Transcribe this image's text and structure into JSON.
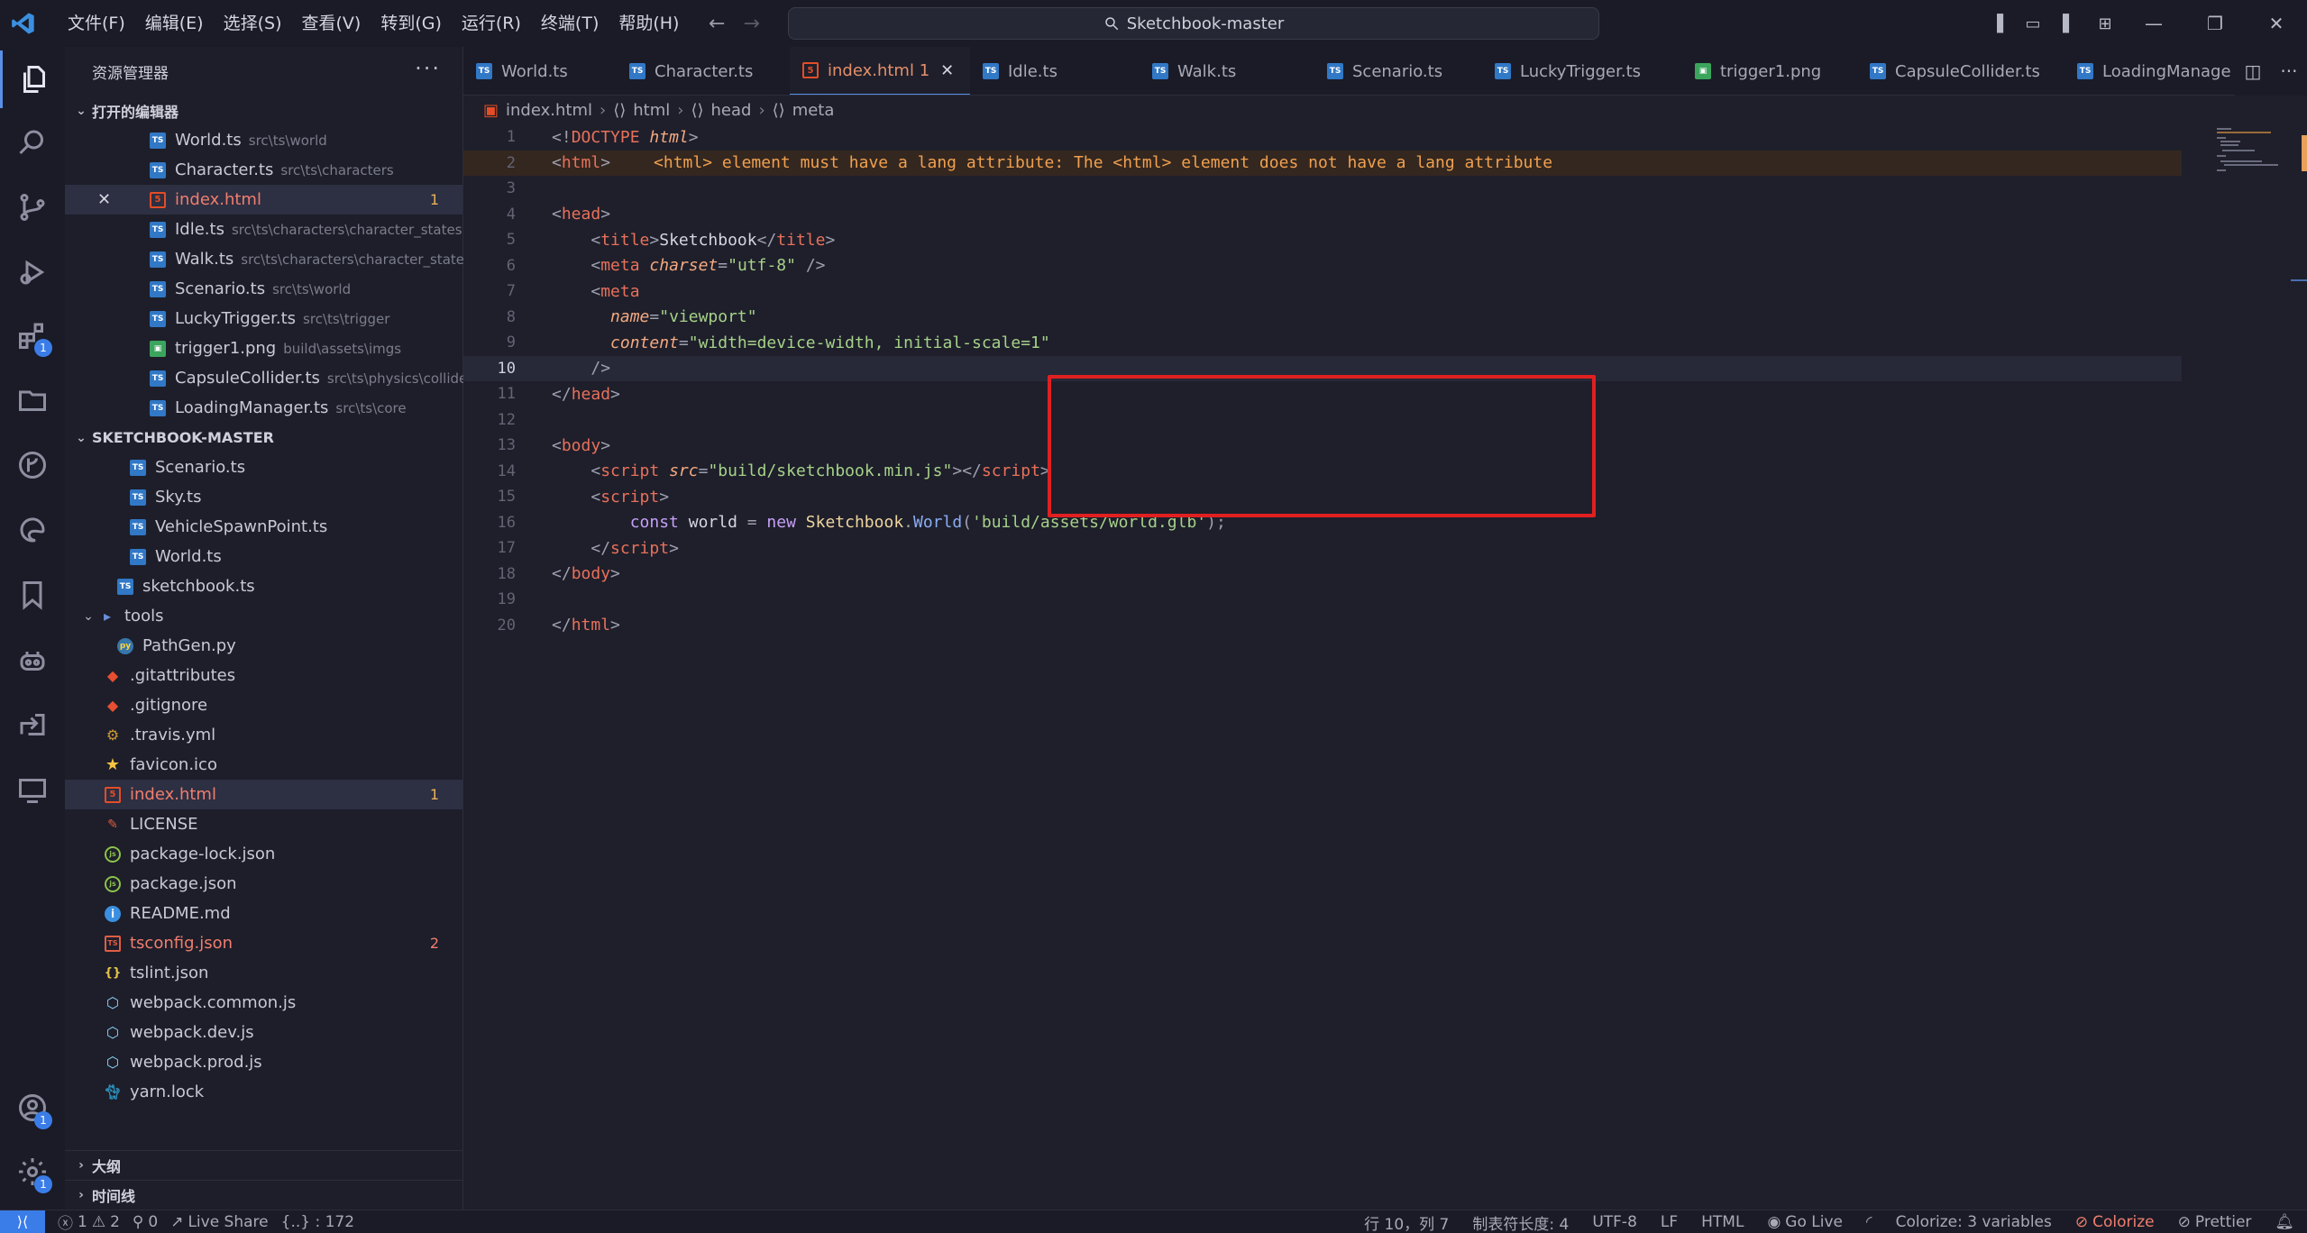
{
  "titlebar": {
    "menu": [
      "文件(F)",
      "编辑(E)",
      "选择(S)",
      "查看(V)",
      "转到(G)",
      "运行(R)",
      "终端(T)",
      "帮助(H)"
    ],
    "search_text": "Sketchbook-master"
  },
  "activitybar": {
    "extensions_badge": "1",
    "accounts_badge": "1",
    "settings_badge": "1"
  },
  "sidebar": {
    "title": "资源管理器",
    "open_editors_title": "打开的编辑器",
    "open_editors": [
      {
        "name": "World.ts",
        "path": "src\\ts\\world",
        "type": "ts"
      },
      {
        "name": "Character.ts",
        "path": "src\\ts\\characters",
        "type": "ts"
      },
      {
        "name": "index.html",
        "path": "",
        "type": "html",
        "badge": "1"
      },
      {
        "name": "Idle.ts",
        "path": "src\\ts\\characters\\character_states",
        "type": "ts"
      },
      {
        "name": "Walk.ts",
        "path": "src\\ts\\characters\\character_states",
        "type": "ts"
      },
      {
        "name": "Scenario.ts",
        "path": "src\\ts\\world",
        "type": "ts"
      },
      {
        "name": "LuckyTrigger.ts",
        "path": "src\\ts\\trigger",
        "type": "ts"
      },
      {
        "name": "trigger1.png",
        "path": "build\\assets\\imgs",
        "type": "png"
      },
      {
        "name": "CapsuleCollider.ts",
        "path": "src\\ts\\physics\\colliders",
        "type": "ts"
      },
      {
        "name": "LoadingManager.ts",
        "path": "src\\ts\\core",
        "type": "ts"
      }
    ],
    "project_title": "SKETCHBOOK-MASTER",
    "tree": [
      {
        "name": "Scenario.ts",
        "type": "ts",
        "indent": 3
      },
      {
        "name": "Sky.ts",
        "type": "ts",
        "indent": 3
      },
      {
        "name": "VehicleSpawnPoint.ts",
        "type": "ts",
        "indent": 3
      },
      {
        "name": "World.ts",
        "type": "ts",
        "indent": 3
      },
      {
        "name": "sketchbook.ts",
        "type": "ts",
        "indent": 2
      },
      {
        "name": "tools",
        "type": "folder",
        "indent": 1
      },
      {
        "name": "PathGen.py",
        "type": "py",
        "indent": 2
      },
      {
        "name": ".gitattributes",
        "type": "git",
        "indent": 1
      },
      {
        "name": ".gitignore",
        "type": "git",
        "indent": 1
      },
      {
        "name": ".travis.yml",
        "type": "yml",
        "indent": 1
      },
      {
        "name": "favicon.ico",
        "type": "star",
        "indent": 1
      },
      {
        "name": "index.html",
        "type": "html",
        "indent": 1,
        "badge": "1",
        "cls": "err"
      },
      {
        "name": "LICENSE",
        "type": "lic",
        "indent": 1
      },
      {
        "name": "package-lock.json",
        "type": "json",
        "indent": 1
      },
      {
        "name": "package.json",
        "type": "json",
        "indent": 1
      },
      {
        "name": "README.md",
        "type": "info",
        "indent": 1
      },
      {
        "name": "tsconfig.json",
        "type": "tsconfig",
        "indent": 1,
        "badge": "2",
        "cls": "err"
      },
      {
        "name": "tslint.json",
        "type": "braces",
        "indent": 1
      },
      {
        "name": "webpack.common.js",
        "type": "webpack",
        "indent": 1
      },
      {
        "name": "webpack.dev.js",
        "type": "webpack",
        "indent": 1
      },
      {
        "name": "webpack.prod.js",
        "type": "webpack",
        "indent": 1
      },
      {
        "name": "yarn.lock",
        "type": "yarn",
        "indent": 1
      }
    ],
    "outline_title": "大纲",
    "timeline_title": "时间线"
  },
  "tabs": [
    {
      "name": "World.ts",
      "type": "ts"
    },
    {
      "name": "Character.ts",
      "type": "ts"
    },
    {
      "name": "index.html 1",
      "type": "html",
      "active": true
    },
    {
      "name": "Idle.ts",
      "type": "ts"
    },
    {
      "name": "Walk.ts",
      "type": "ts"
    },
    {
      "name": "Scenario.ts",
      "type": "ts"
    },
    {
      "name": "LuckyTrigger.ts",
      "type": "ts"
    },
    {
      "name": "trigger1.png",
      "type": "png"
    },
    {
      "name": "CapsuleCollider.ts",
      "type": "ts"
    },
    {
      "name": "LoadingManage",
      "type": "ts"
    }
  ],
  "breadcrumb": [
    "index.html",
    "html",
    "head",
    "meta"
  ],
  "editor": {
    "current_line": 10,
    "diagnostic": "<html> element must have a lang attribute: The <html> element does not have a lang attribute",
    "lines": [
      [
        [
          "t-punc",
          "<!"
        ],
        [
          "t-tag",
          "DOCTYPE"
        ],
        [
          "t-txt",
          " "
        ],
        [
          "t-attr",
          "html"
        ],
        [
          "t-punc",
          ">"
        ]
      ],
      [
        [
          "t-punc",
          "<"
        ],
        [
          "t-tag",
          "html"
        ],
        [
          "t-punc",
          ">"
        ]
      ],
      [],
      [
        [
          "t-punc",
          "<"
        ],
        [
          "t-tag",
          "head"
        ],
        [
          "t-punc",
          ">"
        ]
      ],
      [
        [
          "t-txt",
          "    "
        ],
        [
          "t-punc",
          "<"
        ],
        [
          "t-tag",
          "title"
        ],
        [
          "t-punc",
          ">"
        ],
        [
          "t-txt",
          "Sketchbook"
        ],
        [
          "t-punc",
          "</"
        ],
        [
          "t-tag",
          "title"
        ],
        [
          "t-punc",
          ">"
        ]
      ],
      [
        [
          "t-txt",
          "    "
        ],
        [
          "t-punc",
          "<"
        ],
        [
          "t-tag",
          "meta"
        ],
        [
          "t-txt",
          " "
        ],
        [
          "t-attr",
          "charset"
        ],
        [
          "t-punc",
          "="
        ],
        [
          "t-str",
          "\"utf-8\""
        ],
        [
          "t-txt",
          " "
        ],
        [
          "t-punc",
          "/>"
        ]
      ],
      [
        [
          "t-txt",
          "    "
        ],
        [
          "t-punc",
          "<"
        ],
        [
          "t-tag",
          "meta"
        ]
      ],
      [
        [
          "t-txt",
          "      "
        ],
        [
          "t-attr",
          "name"
        ],
        [
          "t-punc",
          "="
        ],
        [
          "t-str",
          "\"viewport\""
        ]
      ],
      [
        [
          "t-txt",
          "      "
        ],
        [
          "t-attr",
          "content"
        ],
        [
          "t-punc",
          "="
        ],
        [
          "t-str",
          "\"width=device-width, initial-scale=1\""
        ]
      ],
      [
        [
          "t-txt",
          "    "
        ],
        [
          "t-punc",
          "/>"
        ]
      ],
      [
        [
          "t-punc",
          "</"
        ],
        [
          "t-tag",
          "head"
        ],
        [
          "t-punc",
          ">"
        ]
      ],
      [],
      [
        [
          "t-punc",
          "<"
        ],
        [
          "t-tag",
          "body"
        ],
        [
          "t-punc",
          ">"
        ]
      ],
      [
        [
          "t-txt",
          "    "
        ],
        [
          "t-punc",
          "<"
        ],
        [
          "t-tag",
          "script"
        ],
        [
          "t-txt",
          " "
        ],
        [
          "t-attr",
          "src"
        ],
        [
          "t-punc",
          "="
        ],
        [
          "t-str",
          "\"build/sketchbook.min.js\""
        ],
        [
          "t-punc",
          "></"
        ],
        [
          "t-tag",
          "script"
        ],
        [
          "t-punc",
          ">"
        ]
      ],
      [
        [
          "t-txt",
          "    "
        ],
        [
          "t-punc",
          "<"
        ],
        [
          "t-tag",
          "script"
        ],
        [
          "t-punc",
          ">"
        ]
      ],
      [
        [
          "t-txt",
          "        "
        ],
        [
          "t-kw",
          "const"
        ],
        [
          "t-var",
          " world "
        ],
        [
          "t-punc",
          "="
        ],
        [
          "t-kw",
          " new "
        ],
        [
          "t-cls",
          "Sketchbook"
        ],
        [
          "t-punc",
          "."
        ],
        [
          "t-fn",
          "World"
        ],
        [
          "t-punc",
          "("
        ],
        [
          "t-str",
          "'build/assets/world.glb'"
        ],
        [
          "t-punc",
          ");"
        ]
      ],
      [
        [
          "t-txt",
          "    "
        ],
        [
          "t-punc",
          "</"
        ],
        [
          "t-tag",
          "script"
        ],
        [
          "t-punc",
          ">"
        ]
      ],
      [
        [
          "t-punc",
          "</"
        ],
        [
          "t-tag",
          "body"
        ],
        [
          "t-punc",
          ">"
        ]
      ],
      [],
      [
        [
          "t-punc",
          "</"
        ],
        [
          "t-tag",
          "html"
        ],
        [
          "t-punc",
          ">"
        ]
      ]
    ]
  },
  "statusbar": {
    "errors": "1",
    "warnings": "2",
    "ports": "0",
    "live_share": "Live Share",
    "selection": "{..} : 172",
    "position": "行 10，列 7",
    "tab_size": "制表符长度: 4",
    "encoding": "UTF-8",
    "eol": "LF",
    "language": "HTML",
    "go_live": "Go Live",
    "colorize_vars": "Colorize: 3 variables",
    "colorize": "Colorize",
    "prettier": "Prettier"
  },
  "colors": {
    "accent": "#3b7de8",
    "error": "#f07e6e",
    "highlight_box": "#e02020"
  }
}
